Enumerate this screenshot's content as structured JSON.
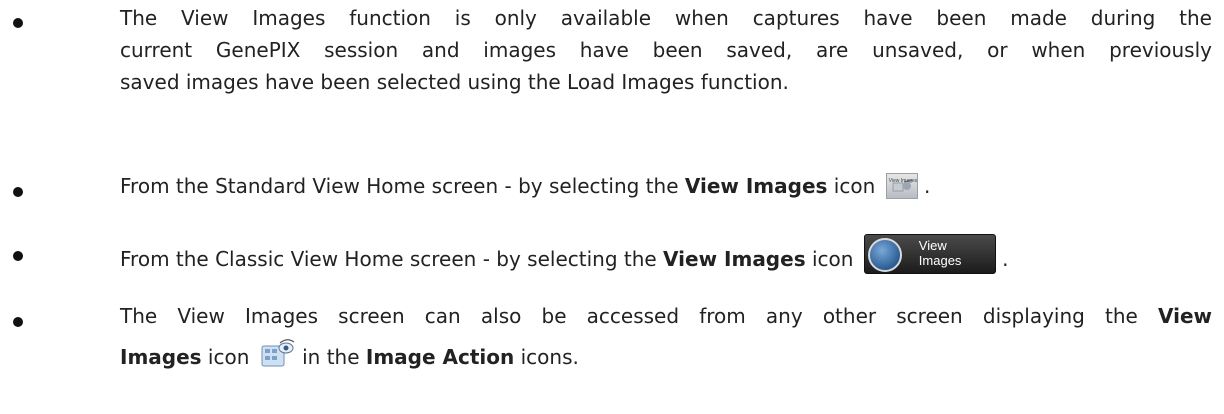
{
  "bullets": [
    {
      "lines": [
        "The View Images function is only available when captures have been made during the",
        "current GenePIX session and images have been saved, are unsaved, or when previously",
        "saved images have been selected using the Load Images function."
      ]
    },
    {
      "prefix": "From the Standard View Home screen - by selecting the ",
      "bold": "View Images",
      "mid": " icon",
      "icon_name": "standard-view-images-icon",
      "icon_caption": "View Images",
      "suffix": " ."
    },
    {
      "prefix": "From the Classic View Home screen - by selecting the ",
      "bold": "View Images",
      "mid": " icon",
      "icon_name": "classic-view-images-icon",
      "icon_label": "View\nImages",
      "suffix": " ."
    },
    {
      "line1_prefix": "The View Images screen can also be accessed from any other screen displaying the ",
      "line1_bold": "View",
      "line2_bold": "Images",
      "line2_mid": " icon",
      "icon_name": "image-action-view-images-icon",
      "line2_after": " in the ",
      "line2_bold2": "Image Action",
      "line2_suffix": " icons."
    }
  ]
}
